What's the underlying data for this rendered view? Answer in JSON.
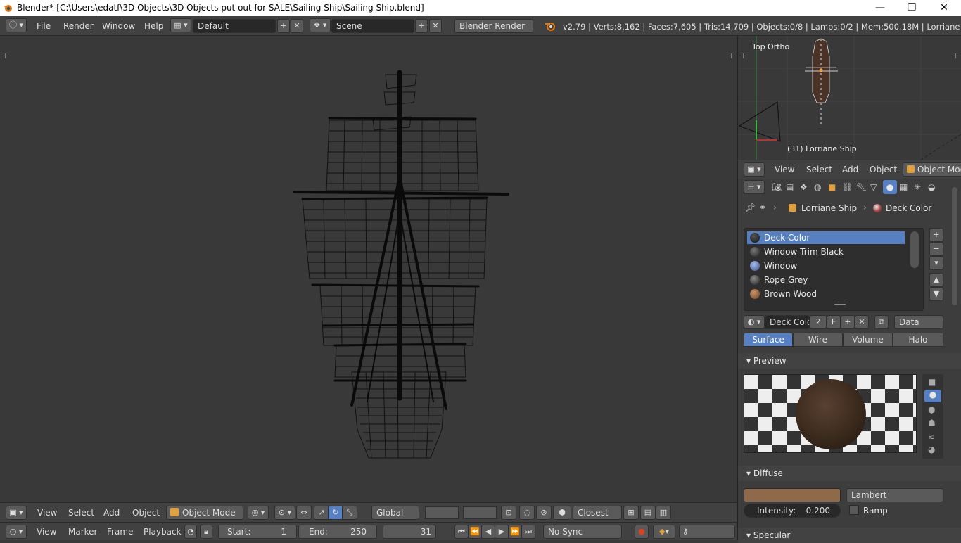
{
  "window": {
    "title": "Blender* [C:\\Users\\edatf\\3D Objects\\3D Objects put out for SALE\\Sailing Ship\\Sailing Ship.blend]",
    "minimize": "—",
    "restore": "❐",
    "close": "✕"
  },
  "info_header": {
    "menus": [
      "File",
      "Render",
      "Window",
      "Help"
    ],
    "screen_layout": "Default",
    "scene": "Scene",
    "render_engine": "Blender Render",
    "stats": "v2.79 | Verts:8,162 | Faces:7,605 | Tris:14,709 | Objects:0/8 | Lamps:0/2 | Mem:500.18M | Lorriane Ship"
  },
  "view3d_header": {
    "menus": [
      "View",
      "Select",
      "Add",
      "Object"
    ],
    "mode": "Object Mode",
    "orientation": "Global",
    "snap": "Closest"
  },
  "timeline": {
    "menus": [
      "View",
      "Marker",
      "Frame",
      "Playback"
    ],
    "start_label": "Start:",
    "start_value": "1",
    "end_label": "End:",
    "end_value": "250",
    "current_frame": "31",
    "sync": "No Sync"
  },
  "mini_view": {
    "view_name": "Top Ortho",
    "object_label": "(31) Lorriane Ship"
  },
  "mini_header": {
    "menus": [
      "View",
      "Select",
      "Add",
      "Object"
    ],
    "mode": "Object Mode"
  },
  "properties": {
    "breadcrumb": [
      "Lorriane Ship",
      "Deck Color"
    ],
    "materials": [
      {
        "name": "Deck Color",
        "color": "#1e1e1e",
        "selected": true
      },
      {
        "name": "Window Trim Black",
        "color": "#333333",
        "selected": false
      },
      {
        "name": "Window",
        "color": "#5670a8",
        "selected": false
      },
      {
        "name": "Rope Grey",
        "color": "#3a3a3a",
        "selected": false
      },
      {
        "name": "Brown Wood",
        "color": "#8a5a32",
        "selected": false
      }
    ],
    "material_name": "Deck Color",
    "users": "2",
    "fake_user": "F",
    "link": "Data",
    "tabs": [
      "Surface",
      "Wire",
      "Volume",
      "Halo"
    ],
    "active_tab": "Surface",
    "preview_label": "Preview",
    "diffuse_label": "Diffuse",
    "diffuse_color": "#8e6a4a",
    "diffuse_shader": "Lambert",
    "intensity_label": "Intensity:",
    "intensity_value": "0.200",
    "ramp_label": "Ramp",
    "specular_label": "Specular",
    "sphere_color": "#3a2a1d"
  }
}
